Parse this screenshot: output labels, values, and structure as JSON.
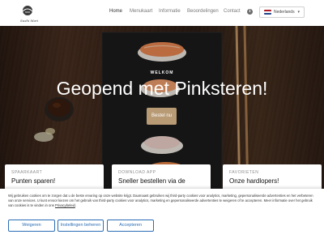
{
  "brand": {
    "logo_text": "Sushi Mori"
  },
  "nav": {
    "items": [
      {
        "label": "Home",
        "active": true
      },
      {
        "label": "Menukaart",
        "active": false
      },
      {
        "label": "Informatie",
        "active": false
      },
      {
        "label": "Beoordelingen",
        "active": false
      },
      {
        "label": "Contact",
        "active": false
      }
    ],
    "info_icon": "info-icon",
    "language": {
      "selected": "Nederlands",
      "flag": "netherlands-flag"
    }
  },
  "hero": {
    "eyebrow": "WELKOM",
    "title": "Geopend met Pinksteren!",
    "cta_label": "Bestel nu"
  },
  "cards": [
    {
      "eyebrow": "SPAARKAART",
      "title": "Punten sparen!"
    },
    {
      "eyebrow": "DOWNLOAD APP",
      "title": "Sneller bestellen via de"
    },
    {
      "eyebrow": "FAVORIETEN",
      "title": "Onze hardlopers!"
    }
  ],
  "cookie": {
    "text": "Wij gebruiken cookies om te zorgen dat u de beste ervaring op onze website krijgt. Daarnaast gebruiken wij third-party cookies voor analytics, marketing, gepersonaliseerde advertenties en het verbeteren van onze services. U kunt ervoor kiezen om het gebruik van third-party cookies voor analytics, marketing en gepersonaliseerde advertenties te weigeren of te accepteren. Meer informatie over het gebruik van cookies is te vinden in ons",
    "privacy_link": "Privacybeleid",
    "buttons": {
      "reject": "Weigeren",
      "manage": "Instellingen beheren",
      "accept": "Accepteren"
    }
  },
  "colors": {
    "accent": "#b89a74",
    "button_blue": "#2a6db5"
  }
}
